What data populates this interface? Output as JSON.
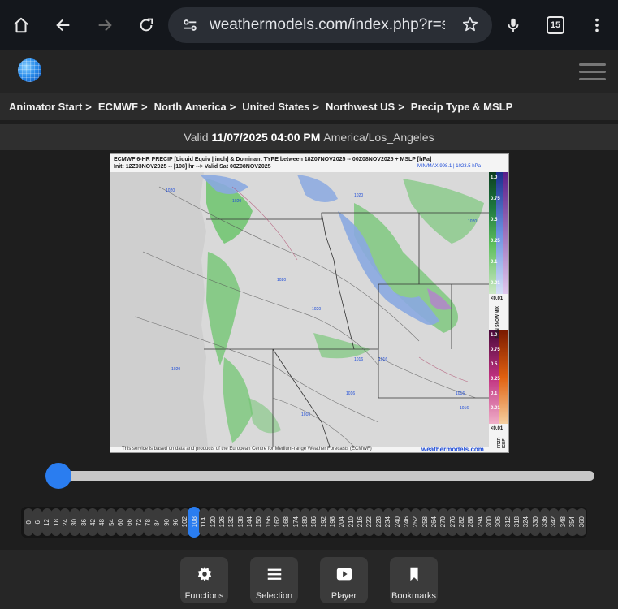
{
  "browser": {
    "url": "weathermodels.com/index.php?r=site",
    "tab_count": "15"
  },
  "breadcrumb": [
    {
      "label": "Animator Start",
      "sep": ">"
    },
    {
      "label": "ECMWF",
      "sep": ">"
    },
    {
      "label": "North America",
      "sep": ">"
    },
    {
      "label": "United States",
      "sep": ">"
    },
    {
      "label": "Northwest US",
      "sep": ">"
    },
    {
      "label": "Precip Type & MSLP",
      "sep": ""
    }
  ],
  "valid": {
    "prefix": "Valid",
    "datetime": "11/07/2025 04:00 PM",
    "timezone": "America/Los_Angeles"
  },
  "map": {
    "header_line1": "ECMWF 6-HR PRECIP [Liquid Equiv | inch] & Dominant TYPE between 18Z07NOV2025 -- 00Z08NOV2025 + MSLP [hPa]",
    "header_line2": "Init: 12Z03NOV2025 -- [108] hr --> Valid Sat 00Z08NOV2025",
    "minmax": "MIN/MAX 998.1 | 1023.5 hPa",
    "footer": "This service is based on data and products of the European Centre for Medium-range Weather Forecasts (ECMWF)",
    "brand": "weathermodels.com",
    "legend_top": [
      "1.0",
      "0.75",
      "0.5",
      "0.25",
      "0.1",
      "0.01"
    ],
    "legend_top_min": "<0.01",
    "legend_top_label": "RAIN SNOW MIX",
    "legend_bottom": [
      "1.0",
      "0.75",
      "0.5",
      "0.25",
      "0.1",
      "0.01"
    ],
    "legend_bottom_min": "<0.01",
    "legend_bottom_label": "FRZR ICEP",
    "isobars": [
      "1020",
      "1020",
      "1020",
      "1020",
      "1020",
      "1020",
      "1020",
      "1016",
      "1016",
      "1016",
      "1016",
      "1016",
      "1016"
    ],
    "colors": {
      "rain": "#5fbf5f",
      "snow": "#8aa8e0",
      "frzr": "#b0307f"
    }
  },
  "slider": {
    "position": 0.0
  },
  "hours": {
    "values": [
      "0",
      "6",
      "12",
      "18",
      "24",
      "30",
      "36",
      "42",
      "48",
      "54",
      "60",
      "66",
      "72",
      "78",
      "84",
      "90",
      "96",
      "102",
      "108",
      "114",
      "120",
      "126",
      "132",
      "138",
      "144",
      "150",
      "156",
      "162",
      "168",
      "174",
      "180",
      "186",
      "192",
      "198",
      "204",
      "210",
      "216",
      "222",
      "228",
      "234",
      "240",
      "246",
      "252",
      "258",
      "264",
      "270",
      "276",
      "282",
      "288",
      "294",
      "300",
      "306",
      "312",
      "318",
      "324",
      "330",
      "336",
      "342",
      "348",
      "354",
      "360"
    ],
    "active": "108"
  },
  "bottom_nav": [
    {
      "label": "Functions",
      "icon": "gear-icon"
    },
    {
      "label": "Selection",
      "icon": "list-icon"
    },
    {
      "label": "Player",
      "icon": "play-icon"
    },
    {
      "label": "Bookmarks",
      "icon": "bookmark-icon"
    }
  ]
}
